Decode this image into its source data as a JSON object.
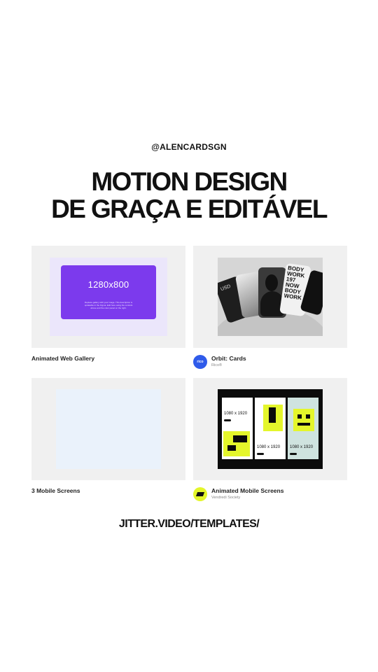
{
  "handle": "@ALENCARDSGN",
  "headline": {
    "line1": "MOTION DESIGN",
    "line2": "DE GRAÇA E EDITÁVEL"
  },
  "templates": [
    {
      "title": "Animated Web Gallery",
      "preview": {
        "resolution": "1280x800",
        "caption": "Replace gallery with your image. This description is updatable in the Figma. Edit here using the controls above and the color panel on the right."
      }
    },
    {
      "title": "Orbit: Cards",
      "author": "Rico®",
      "avatar_text": "rico",
      "avatar_color": "#2f5bea",
      "preview": {
        "usd_text": "USD",
        "poster_text": "BODY WORK 197 NOW BODY WORK"
      }
    },
    {
      "title": "3 Mobile Screens"
    },
    {
      "title": "Animated Mobile Screens",
      "author": "Vendredi Society",
      "avatar_color": "#e4f62b",
      "preview": {
        "screen_label": "1080 x 1920"
      }
    }
  ],
  "footer_url": "JITTER.VIDEO/TEMPLATES/",
  "colors": {
    "accent_purple": "#7c3aed",
    "accent_lime": "#e4f62b"
  }
}
